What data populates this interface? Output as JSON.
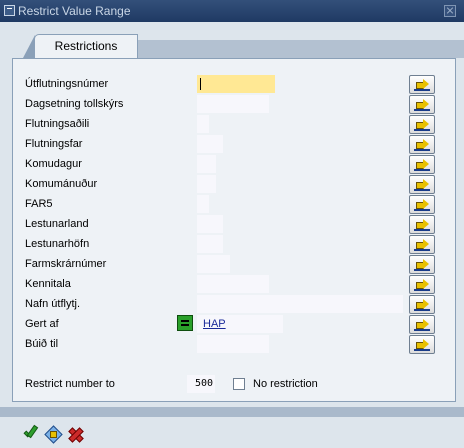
{
  "window": {
    "title": "Restrict Value Range"
  },
  "tabs": [
    {
      "label": "Restrictions",
      "selected": true
    }
  ],
  "fields": [
    {
      "label": "Útflutningsnúmer",
      "value": "",
      "focused": true
    },
    {
      "label": "Dagsetning tollskýrs",
      "value": ""
    },
    {
      "label": "Flutningsaðili",
      "value": ""
    },
    {
      "label": "Flutningsfar",
      "value": ""
    },
    {
      "label": "Komudagur",
      "value": ""
    },
    {
      "label": "Komumánuður",
      "value": ""
    },
    {
      "label": "FAR5",
      "value": ""
    },
    {
      "label": "Lestunarland",
      "value": ""
    },
    {
      "label": "Lestunarhöfn",
      "value": ""
    },
    {
      "label": "Farmskrárnúmer",
      "value": ""
    },
    {
      "label": "Kennitala",
      "value": ""
    },
    {
      "label": "Nafn útflytj.",
      "value": ""
    },
    {
      "label": "Gert af",
      "value": "HAP",
      "operator": "equal"
    },
    {
      "label": "Búið til",
      "value": ""
    }
  ],
  "restrict": {
    "label": "Restrict number to",
    "value": "500",
    "no_restriction_label": "No restriction",
    "no_restriction_checked": false
  },
  "footer": {
    "buttons": [
      {
        "name": "execute",
        "icon": "check-icon"
      },
      {
        "name": "find",
        "icon": "find-icon"
      },
      {
        "name": "cancel",
        "icon": "cancel-icon"
      }
    ]
  },
  "colors": {
    "title_bar": "#1f3a63",
    "focus_field": "#ffe894",
    "value_text": "#1a2a9a"
  }
}
